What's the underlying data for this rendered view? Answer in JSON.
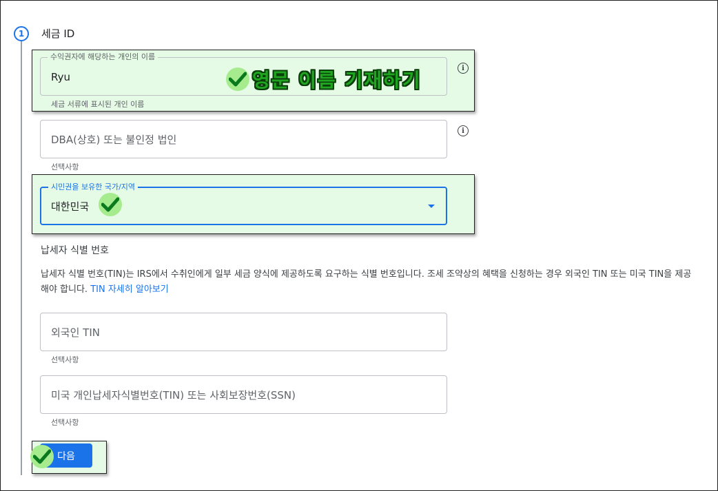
{
  "step": {
    "number": "1",
    "title": "세금 ID"
  },
  "fields": {
    "payee_name": {
      "label": "수익권자에 해당하는 개인의 이름",
      "value": "Ryu",
      "helper": "세금 서류에 표시된 개인 이름"
    },
    "dba": {
      "placeholder": "DBA(상호) 또는 불인정 법인",
      "helper": "선택사항"
    },
    "citizenship": {
      "label": "시민권을 보유한 국가/지역",
      "value": "대한민국"
    },
    "foreign_tin": {
      "placeholder": "외국인 TIN",
      "helper": "선택사항"
    },
    "us_tin": {
      "placeholder": "미국 개인납세자식별번호(TIN) 또는 사회보장번호(SSN)",
      "helper": "선택사항"
    }
  },
  "tin_section": {
    "title": "납세자 식별 번호",
    "description": "납세자 식별 번호(TIN)는 IRS에서 수취인에게 일부 세금 양식에 제공하도록 요구하는 식별 번호입니다. 조세 조약상의 혜택을 신청하는 경우 외국인 TIN 또는 미국 TIN을 제공해야 합니다.",
    "link": "TIN 자세히 알아보기"
  },
  "annotation": {
    "text": "영문 이름 기재하기"
  },
  "buttons": {
    "next": "다음"
  },
  "icons": {
    "info": "info-icon",
    "check": "check-mark-icon",
    "dropdown": "dropdown-arrow-icon"
  },
  "colors": {
    "accent": "#1a73e8",
    "highlight": "#e6fbe6",
    "check": "#1fa51f"
  }
}
